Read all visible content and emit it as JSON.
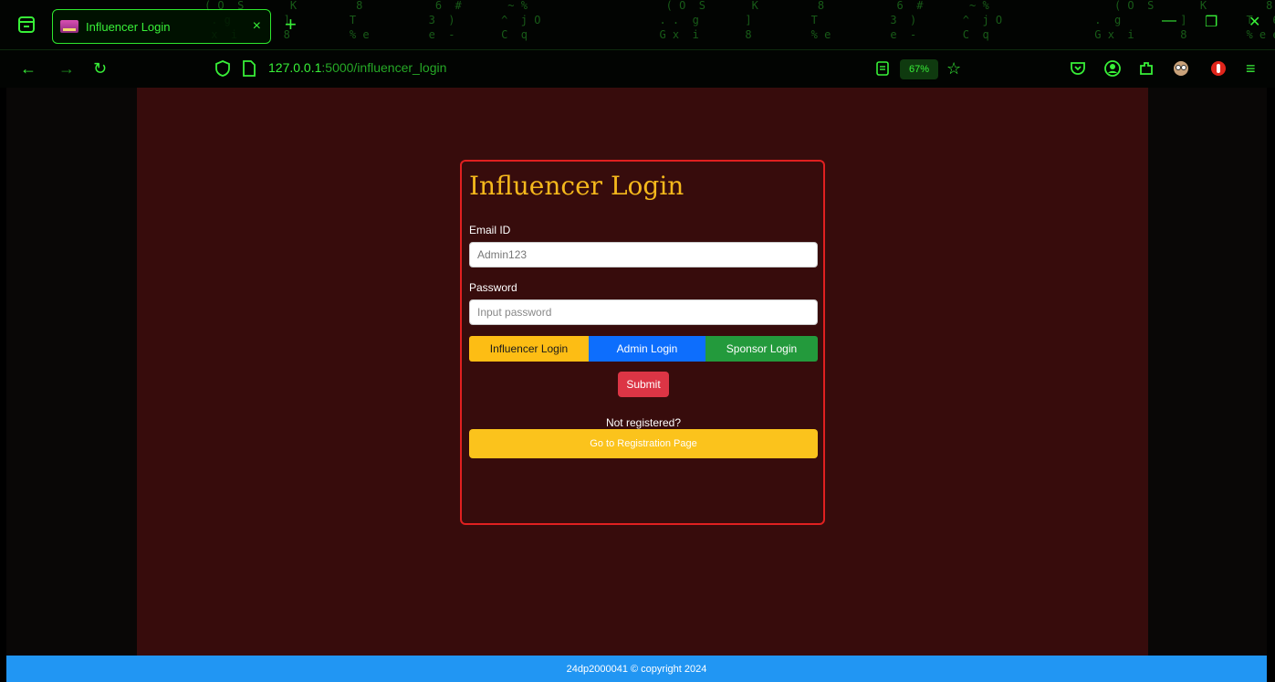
{
  "browser": {
    "tab_title": "Influencer Login",
    "tab_close": "×",
    "new_tab": "+",
    "url_host": "127.0.0.1",
    "url_path": ":5000/influencer_login",
    "zoom": "67%",
    "window_minimize": "—",
    "window_restore": "❐",
    "window_close": "✕",
    "matrix_rows": [
      "                               ( O  S       K         8           6  #       ~ %                     ( O  S       K         8           6  #       ~ %                   ( O  S       K         8        8",
      "                                . g        ]         T           3  )       ^  j O                  . .  g       ]         T           3  )       ^  j O              .  g         ]         T   6",
      "                                x  i       8         % e         e  -       C  q                    G x  i       8         % e         e  -       C  q                G x  i       8         % e e"
    ]
  },
  "form": {
    "title": "Influencer Login",
    "email_label": "Email ID",
    "email_value": "Admin123",
    "password_label": "Password",
    "password_placeholder": "Input password",
    "role_influencer": "Influencer Login",
    "role_admin": "Admin Login",
    "role_sponsor": "Sponsor Login",
    "submit": "Submit",
    "not_registered": "Not registered?",
    "register_button": "Go to Registration Page"
  },
  "footer": {
    "text": "24dp2000041 © copyright 2024"
  },
  "colors": {
    "card_border": "#e02020",
    "title": "#f5b81c",
    "influencer_btn": "#fdbd14",
    "admin_btn": "#0d6efd",
    "sponsor_btn": "#239a3c",
    "submit_btn": "#dc3545",
    "footer": "#2196f3"
  }
}
